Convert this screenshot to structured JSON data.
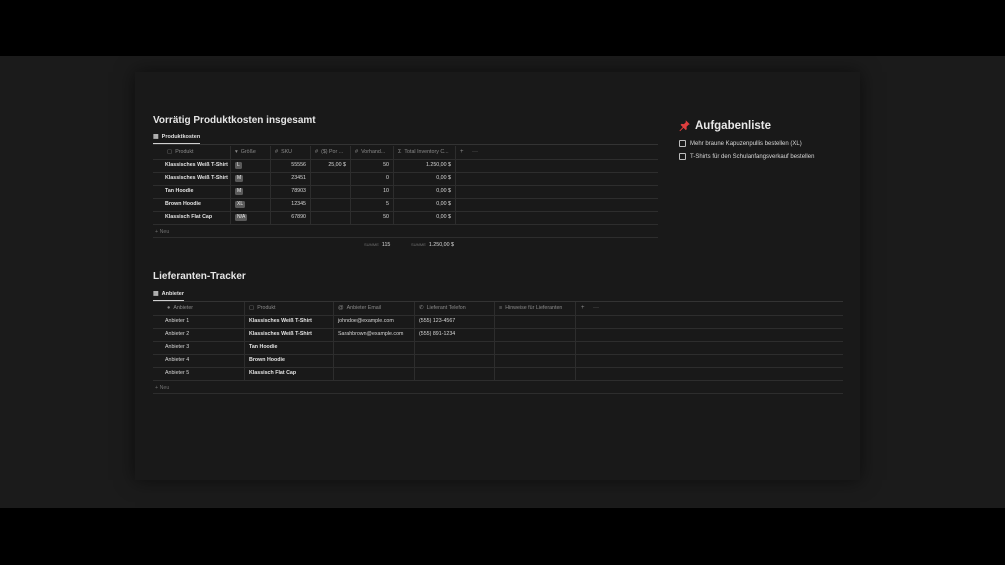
{
  "section1": {
    "title": "Vorrätig Produktkosten insgesamt",
    "tab": "Produktkosten",
    "columns": [
      "Produkt",
      "Größe",
      "SKU",
      "($) Por ...",
      "Vorhand...",
      "Total Inventory C..."
    ],
    "rows": [
      {
        "produkt": "Klassisches Weiß T-Shirt",
        "groesse": "L",
        "sku": "55556",
        "preis": "25,00 $",
        "vorhanden": "50",
        "total": "1.250,00 $"
      },
      {
        "produkt": "Klassisches Weiß T-Shirt",
        "groesse": "M",
        "sku": "23451",
        "preis": "",
        "vorhanden": "0",
        "total": "0,00 $"
      },
      {
        "produkt": "Tan Hoodie",
        "groesse": "M",
        "sku": "78903",
        "preis": "",
        "vorhanden": "10",
        "total": "0,00 $"
      },
      {
        "produkt": "Brown Hoodie",
        "groesse": "XL",
        "sku": "12345",
        "preis": "",
        "vorhanden": "5",
        "total": "0,00 $"
      },
      {
        "produkt": "Klassisch Flat Cap",
        "groesse": "N/A",
        "sku": "67890",
        "preis": "",
        "vorhanden": "50",
        "total": "0,00 $"
      }
    ],
    "new_label": "+ Neu",
    "sum_label_1": "SUMME",
    "sum_value_1": "115",
    "sum_label_2": "SUMME",
    "sum_value_2": "1.250,00 $",
    "plus": "+",
    "more": "···"
  },
  "section2": {
    "title": "Lieferanten-Tracker",
    "tab": "Anbieter",
    "columns": [
      "Anbieter",
      "Produkt",
      "Anbieter Email",
      "Lieferant Telefon",
      "Hinweise für Lieferanten"
    ],
    "rows": [
      {
        "anbieter": "Anbieter 1",
        "produkt": "Klassisches Weiß T-Shirt",
        "email": "johndoe@example.com",
        "telefon": "(555) 123-4567",
        "hinweise": ""
      },
      {
        "anbieter": "Anbieter 2",
        "produkt": "Klassisches Weiß T-Shirt",
        "email": "Sarahbrown@example.com",
        "telefon": "(555) 891-1234",
        "hinweise": ""
      },
      {
        "anbieter": "Anbieter 3",
        "produkt": "Tan Hoodie",
        "email": "",
        "telefon": "",
        "hinweise": ""
      },
      {
        "anbieter": "Anbieter 4",
        "produkt": "Brown Hoodie",
        "email": "",
        "telefon": "",
        "hinweise": ""
      },
      {
        "anbieter": "Anbieter 5",
        "produkt": "Klassisch Flat Cap",
        "email": "",
        "telefon": "",
        "hinweise": ""
      }
    ],
    "new_label": "+ Neu",
    "plus": "+",
    "more": "···"
  },
  "todo": {
    "icon": "pushpin-icon",
    "title": "Aufgabenliste",
    "items": [
      "Mehr braune Kapuzenpullis bestellen (XL)",
      "T-Shirts für den Schulanfangsverkauf bestellen"
    ]
  },
  "colors": {
    "background": "#1b1b1b",
    "panel": "#191919",
    "badge": "#5a5a5a",
    "pin": "#e03e3e"
  }
}
